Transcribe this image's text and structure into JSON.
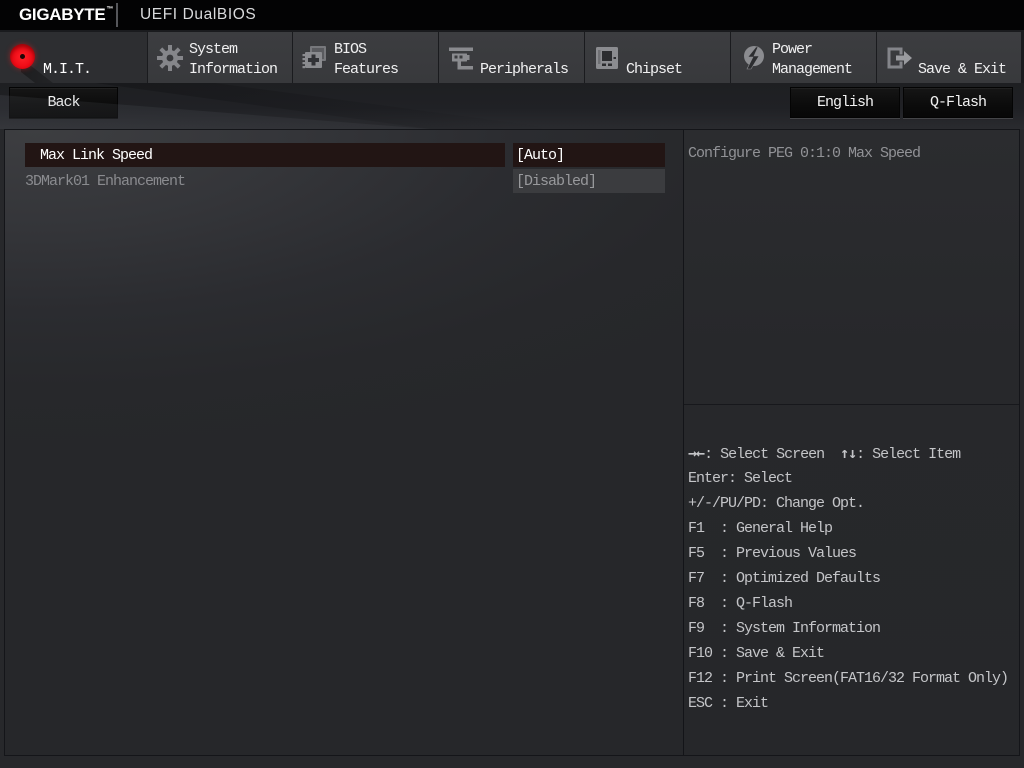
{
  "header": {
    "brand": "GIGABYTE",
    "brand_tm": "™",
    "firmware_title": "UEFI DualBIOS"
  },
  "tabs": [
    {
      "id": "mit",
      "label": "M.I.T.",
      "lines": [
        "M.I.T."
      ],
      "icon": "mit-orb-icon",
      "active": true
    },
    {
      "id": "system-information",
      "label": "System Information",
      "lines": [
        "System",
        "Information"
      ],
      "icon": "gear-icon",
      "active": false
    },
    {
      "id": "bios-features",
      "label": "BIOS Features",
      "lines": [
        "BIOS",
        "Features"
      ],
      "icon": "bios-chip-icon",
      "active": false
    },
    {
      "id": "peripherals",
      "label": "Peripherals",
      "lines": [
        "Peripherals"
      ],
      "icon": "peripherals-icon",
      "active": false
    },
    {
      "id": "chipset",
      "label": "Chipset",
      "lines": [
        "Chipset"
      ],
      "icon": "chipset-icon",
      "active": false
    },
    {
      "id": "power-management",
      "label": "Power Management",
      "lines": [
        "Power",
        "Management"
      ],
      "icon": "power-icon",
      "active": false
    },
    {
      "id": "save-exit",
      "label": "Save & Exit",
      "lines": [
        "Save & Exit"
      ],
      "icon": "save-exit-icon",
      "active": false
    }
  ],
  "toolbar": {
    "back_label": "Back",
    "language_label": "English",
    "qflash_label": "Q-Flash"
  },
  "settings": [
    {
      "label": "Max Link Speed",
      "value": "[Auto]",
      "selected": true
    },
    {
      "label": "3DMark01 Enhancement",
      "value": "[Disabled]",
      "selected": false
    }
  ],
  "help": {
    "description": "Configure PEG 0:1:0 Max Speed",
    "select_line": {
      "left_sym": "→←",
      "left_text": ": Select Screen",
      "right_sym": "↑↓",
      "right_text": ": Select Item"
    },
    "keys": [
      "Enter: Select",
      "+/-/PU/PD: Change Opt.",
      "F1  : General Help",
      "F5  : Previous Values",
      "F7  : Optimized Defaults",
      "F8  : Q-Flash",
      "F9  : System Information",
      "F10 : Save & Exit",
      "F12 : Print Screen(FAT16/32 Format Only)",
      "ESC : Exit"
    ]
  },
  "colors": {
    "accent_red": "#e8111c",
    "selected_row_bg": "#221514",
    "tab_bg": "#3a3b3e",
    "topbar_bg": "#030304"
  }
}
